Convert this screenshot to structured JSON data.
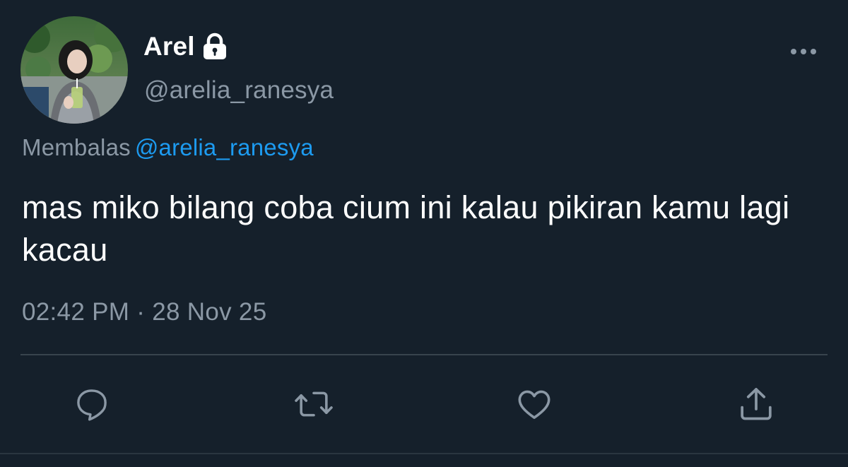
{
  "user": {
    "display_name": "Arel",
    "handle": "@arelia_ranesya",
    "protected_icon": "lock-icon"
  },
  "reply": {
    "prefix": "Membalas",
    "mention": "@arelia_ranesya"
  },
  "tweet": {
    "text": "mas miko bilang coba cium ini kalau pikiran kamu lagi kacau",
    "timestamp": "02:42 PM · 28 Nov 25"
  },
  "actions": [
    {
      "name": "reply",
      "icon": "comment-icon"
    },
    {
      "name": "retweet",
      "icon": "retweet-icon"
    },
    {
      "name": "like",
      "icon": "heart-icon"
    },
    {
      "name": "share",
      "icon": "share-icon"
    }
  ],
  "colors": {
    "background": "#15202b",
    "primary_text": "#ffffff",
    "secondary_text": "#8b98a5",
    "link": "#1d9bf0",
    "divider": "#38444d"
  }
}
